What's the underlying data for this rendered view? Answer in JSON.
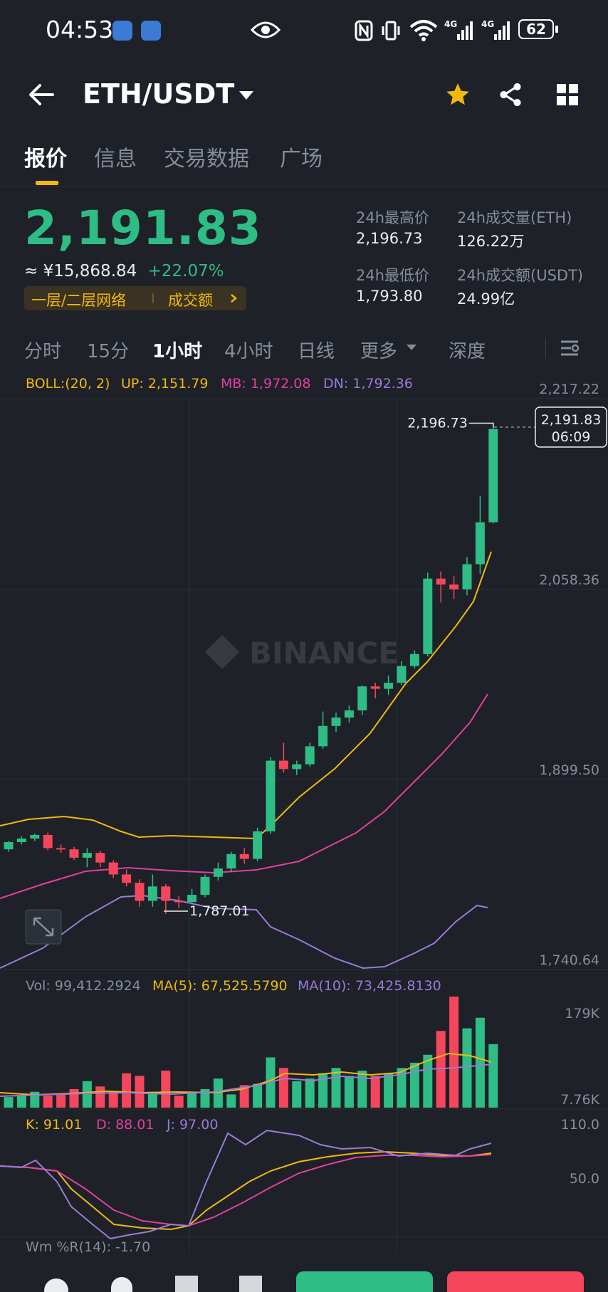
{
  "status_bar": {
    "time": "04:53",
    "battery": "62"
  },
  "header": {
    "title": "ETH/USDT",
    "icons": [
      "back-arrow-icon",
      "chevron-down-icon",
      "star-icon",
      "share-icon",
      "grid-icon"
    ]
  },
  "tabs": [
    {
      "label": "报价",
      "active": true
    },
    {
      "label": "信息",
      "active": false
    },
    {
      "label": "交易数据",
      "active": false
    },
    {
      "label": "广场",
      "active": false
    }
  ],
  "price": {
    "last": "2,191.83",
    "cny": "≈ ¥15,868.84",
    "change": "+22.07%",
    "network_label": "一层/二层网络",
    "network_link": "成交额"
  },
  "stats": {
    "high_label": "24h最高价",
    "high": "2,196.73",
    "low_label": "24h最低价",
    "low": "1,793.80",
    "vol_eth_label": "24h成交量(ETH)",
    "vol_eth": "126.22万",
    "vol_usdt_label": "24h成交额(USDT)",
    "vol_usdt": "24.99亿"
  },
  "intervals": [
    {
      "label": "分时",
      "active": false
    },
    {
      "label": "15分",
      "active": false
    },
    {
      "label": "1小时",
      "active": true
    },
    {
      "label": "4小时",
      "active": false
    },
    {
      "label": "日线",
      "active": false
    },
    {
      "label": "更多",
      "active": false
    },
    {
      "label": "深度",
      "active": false
    }
  ],
  "indicators": {
    "boll": "BOLL:(20, 2)",
    "up": "UP: 2,151.79",
    "mb": "MB: 1,972.08",
    "dn": "DN: 1,792.36",
    "vol": "Vol: 99,412.2924",
    "ma5": "MA(5): 67,525.5790",
    "ma10": "MA(10): 73,425.8130",
    "k": "K: 91.01",
    "d": "D: 88.01",
    "j": "J: 97.00",
    "wr": "Wm %R(14): -1.70"
  },
  "axis": {
    "price_ticks": [
      "2,217.22",
      "2,058.36",
      "1,899.50",
      "1,740.64"
    ],
    "vol_ticks": [
      "179K",
      "7.76K"
    ],
    "kdj_ticks": [
      "110.0",
      "50.0"
    ],
    "high_marker": "2,196.73",
    "low_marker": "1,787.01",
    "current_price_tag": "2,191.83",
    "countdown": "06:09"
  },
  "watermark": "BINANCE",
  "colors": {
    "up": "#2ebd85",
    "down": "#f6465d",
    "boll_up": "#f0b90b",
    "boll_mb": "#e040a0",
    "boll_dn": "#9b7ad8",
    "accent": "#f0b90b"
  },
  "chart_data": {
    "type": "candlestick",
    "ylim": [
      1740.64,
      2217.22
    ],
    "candles": [
      {
        "o": 1841,
        "c": 1847,
        "h": 1848,
        "l": 1839
      },
      {
        "o": 1847,
        "c": 1850,
        "h": 1852,
        "l": 1845
      },
      {
        "o": 1850,
        "c": 1853,
        "h": 1854,
        "l": 1848
      },
      {
        "o": 1853,
        "c": 1842,
        "h": 1855,
        "l": 1840
      },
      {
        "o": 1842,
        "c": 1841,
        "h": 1845,
        "l": 1838
      },
      {
        "o": 1841,
        "c": 1834,
        "h": 1843,
        "l": 1832
      },
      {
        "o": 1834,
        "c": 1838,
        "h": 1842,
        "l": 1826
      },
      {
        "o": 1838,
        "c": 1830,
        "h": 1840,
        "l": 1826
      },
      {
        "o": 1830,
        "c": 1820,
        "h": 1832,
        "l": 1817
      },
      {
        "o": 1820,
        "c": 1813,
        "h": 1824,
        "l": 1810
      },
      {
        "o": 1813,
        "c": 1798,
        "h": 1816,
        "l": 1793
      },
      {
        "o": 1798,
        "c": 1810,
        "h": 1820,
        "l": 1793
      },
      {
        "o": 1810,
        "c": 1798,
        "h": 1812,
        "l": 1787
      },
      {
        "o": 1798,
        "c": 1797,
        "h": 1802,
        "l": 1792
      },
      {
        "o": 1797,
        "c": 1803,
        "h": 1808,
        "l": 1795
      },
      {
        "o": 1803,
        "c": 1818,
        "h": 1820,
        "l": 1801
      },
      {
        "o": 1818,
        "c": 1825,
        "h": 1830,
        "l": 1815
      },
      {
        "o": 1825,
        "c": 1837,
        "h": 1839,
        "l": 1822
      },
      {
        "o": 1837,
        "c": 1833,
        "h": 1842,
        "l": 1829
      },
      {
        "o": 1833,
        "c": 1856,
        "h": 1859,
        "l": 1831
      },
      {
        "o": 1856,
        "c": 1915,
        "h": 1918,
        "l": 1854
      },
      {
        "o": 1915,
        "c": 1908,
        "h": 1930,
        "l": 1905
      },
      {
        "o": 1908,
        "c": 1912,
        "h": 1915,
        "l": 1903
      },
      {
        "o": 1912,
        "c": 1927,
        "h": 1930,
        "l": 1910
      },
      {
        "o": 1927,
        "c": 1944,
        "h": 1956,
        "l": 1925
      },
      {
        "o": 1944,
        "c": 1951,
        "h": 1955,
        "l": 1939
      },
      {
        "o": 1951,
        "c": 1957,
        "h": 1961,
        "l": 1947
      },
      {
        "o": 1957,
        "c": 1977,
        "h": 1978,
        "l": 1953
      },
      {
        "o": 1977,
        "c": 1975,
        "h": 1980,
        "l": 1967
      },
      {
        "o": 1975,
        "c": 1980,
        "h": 1986,
        "l": 1970
      },
      {
        "o": 1980,
        "c": 1994,
        "h": 1998,
        "l": 1978
      },
      {
        "o": 1994,
        "c": 2004,
        "h": 2007,
        "l": 1992
      },
      {
        "o": 2004,
        "c": 2067,
        "h": 2072,
        "l": 2002
      },
      {
        "o": 2067,
        "c": 2062,
        "h": 2073,
        "l": 2047
      },
      {
        "o": 2062,
        "c": 2058,
        "h": 2069,
        "l": 2050
      },
      {
        "o": 2058,
        "c": 2079,
        "h": 2085,
        "l": 2053
      },
      {
        "o": 2079,
        "c": 2114,
        "h": 2136,
        "l": 2071
      },
      {
        "o": 2114,
        "c": 2191.83,
        "h": 2196.73,
        "l": 2113
      }
    ],
    "volumes": [
      8,
      9,
      12,
      9,
      10,
      14,
      20,
      16,
      12,
      26,
      24,
      12,
      28,
      9,
      12,
      14,
      22,
      10,
      17,
      18,
      38,
      30,
      20,
      22,
      26,
      30,
      24,
      28,
      24,
      26,
      30,
      34,
      40,
      58,
      84,
      60,
      68,
      48
    ],
    "vol_ylim": [
      7.76,
      179
    ]
  }
}
